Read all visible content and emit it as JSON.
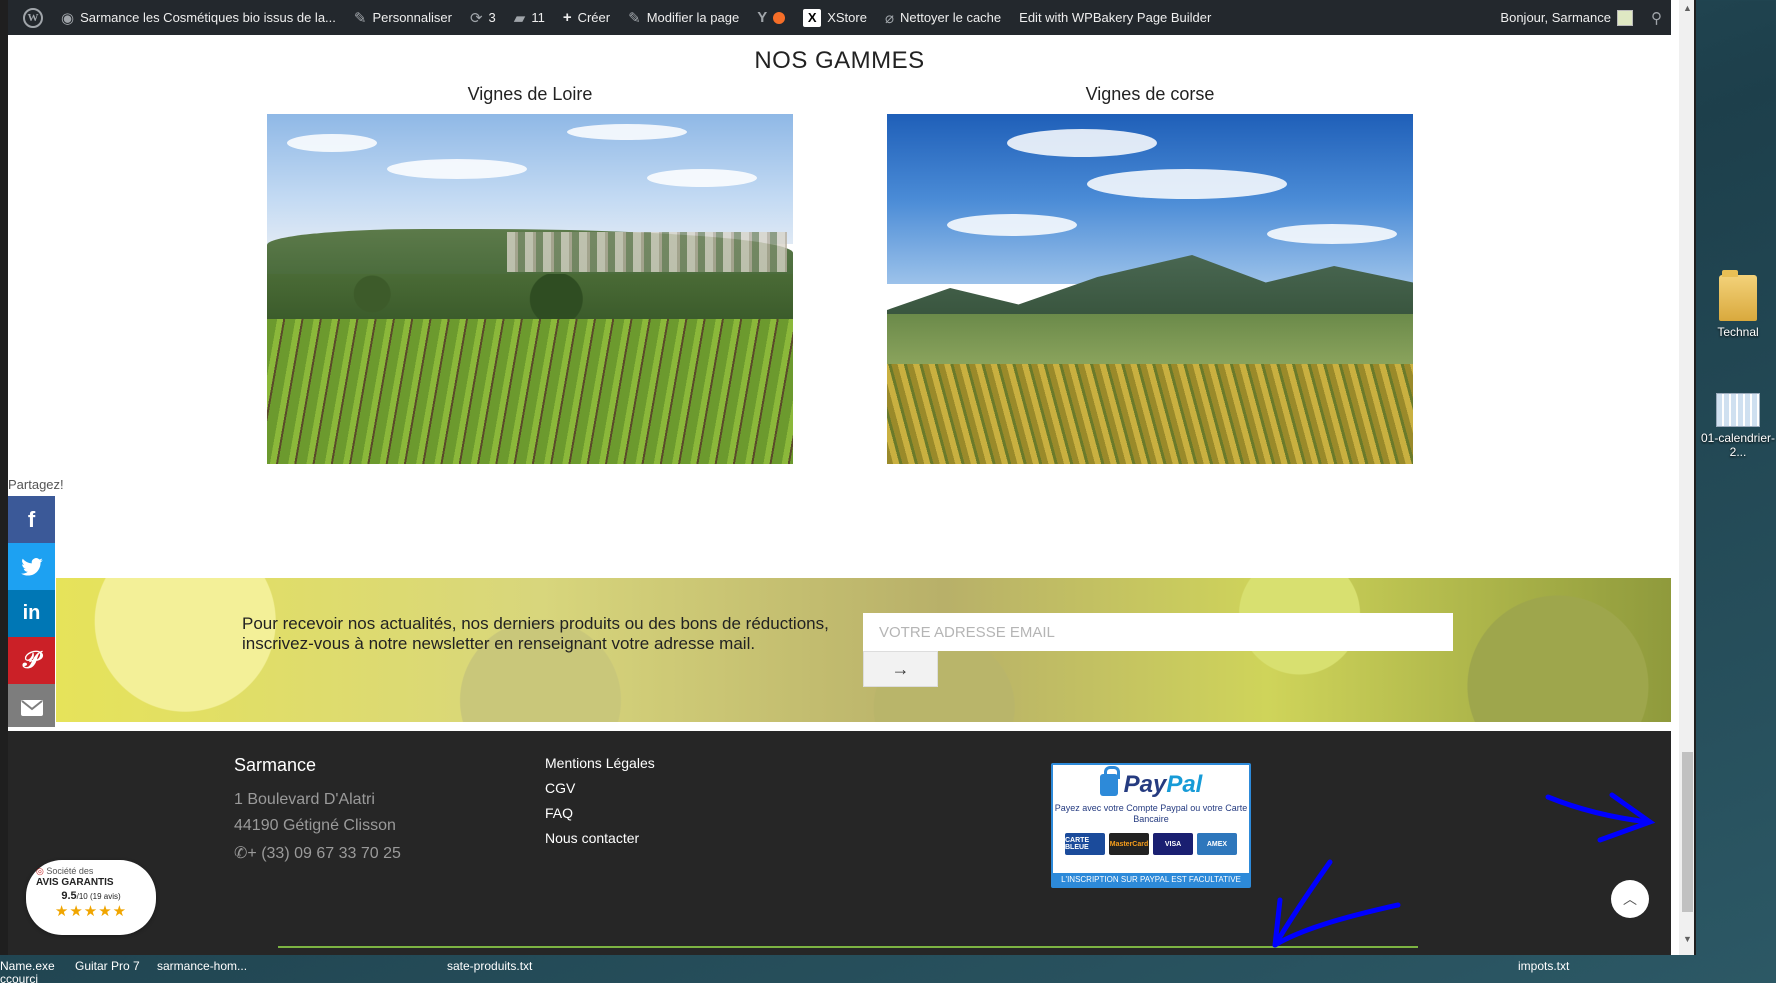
{
  "admin_bar": {
    "site_title": "Sarmance les Cosmétiques bio issus de la...",
    "customize": "Personnaliser",
    "updates_count": "3",
    "comments_count": "11",
    "new": "Créer",
    "edit_page": "Modifier la page",
    "xstore": "XStore",
    "clear_cache": "Nettoyer le cache",
    "wpbakery": "Edit with WPBakery Page Builder",
    "greeting": "Bonjour, Sarmance"
  },
  "main": {
    "section_title": "NOS GAMMES",
    "galleries": [
      {
        "label": "Vignes de Loire"
      },
      {
        "label": "Vignes de corse"
      }
    ]
  },
  "share": {
    "label": "Partagez!",
    "buttons": [
      "facebook",
      "twitter",
      "linkedin",
      "pinterest",
      "email"
    ],
    "colors": {
      "facebook": "#3b5998",
      "twitter": "#1da1f2",
      "linkedin": "#0077b5",
      "pinterest": "#cb2027",
      "email": "#7d7d7d"
    }
  },
  "newsletter": {
    "text": "Pour recevoir nos actualités, nos derniers produits ou des bons de réductions, inscrivez-vous à notre newsletter en renseignant votre adresse mail.",
    "placeholder": "VOTRE ADRESSE EMAIL",
    "submit_label": "→"
  },
  "footer": {
    "brand": "Sarmance",
    "address_line1": "1 Boulevard D'Alatri",
    "address_line2": "44190 Gétigné Clisson",
    "phone": "+ (33) 09 67 33 70 25",
    "links": [
      "Mentions Légales",
      "CGV",
      "FAQ",
      "Nous contacter"
    ],
    "paypal": {
      "logo_a": "Pay",
      "logo_b": "Pal",
      "subtitle": "Payez avec votre Compte Paypal ou votre Carte Bancaire",
      "cards": [
        "CARTE BLEUE",
        "MasterCard",
        "VISA",
        "AMEX"
      ],
      "footer_text": "L'INSCRIPTION SUR PAYPAL EST FACULTATIVE"
    }
  },
  "avis_badge": {
    "line1": "Société des",
    "line2": "AVIS GARANTIS",
    "score": "9.5",
    "score_suffix": "/10 (19 avis)",
    "stars": "★★★★★"
  },
  "desktop": {
    "icons": [
      {
        "label": "Technal"
      },
      {
        "label": "01-calendrier-2..."
      }
    ],
    "taskbar": [
      "Name.exe",
      "Guitar Pro 7",
      "sarmance-hom...",
      "sate-produits.txt",
      "impots.txt",
      "ccourci"
    ]
  },
  "colors": {
    "admin_bar_bg": "#23282d",
    "footer_bg": "#262626",
    "annotation_blue": "#0000ff"
  }
}
